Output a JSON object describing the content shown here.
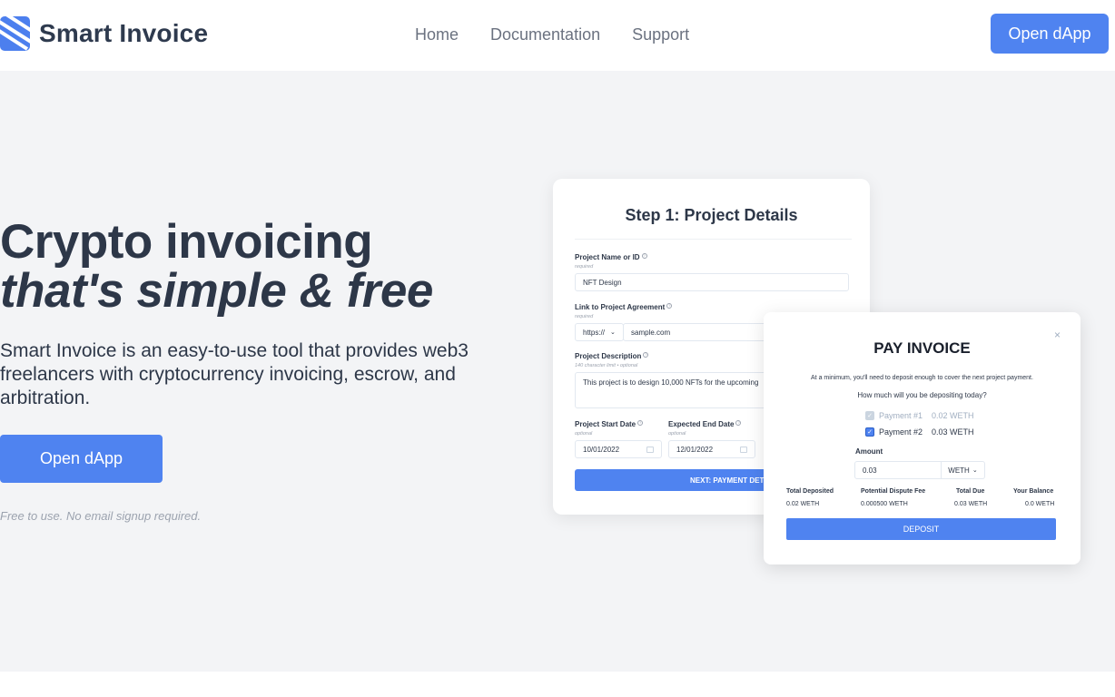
{
  "brand": {
    "name": "Smart Invoice",
    "accent": "#4f83f0"
  },
  "nav": {
    "items": [
      "Home",
      "Documentation",
      "Support"
    ],
    "cta": "Open dApp"
  },
  "hero": {
    "title_line1": "Crypto invoicing",
    "title_line2": "that's simple & free",
    "description": "Smart Invoice is an easy-to-use tool that provides web3 freelancers with cryptocurrency invoicing, escrow, and arbitration.",
    "cta": "Open dApp",
    "note": "Free to use. No email signup required."
  },
  "step_card": {
    "title": "Step 1: Project Details",
    "project_name": {
      "label": "Project Name or ID",
      "hint": "required",
      "value": "NFT Design"
    },
    "project_link": {
      "label": "Link to Project Agreement",
      "hint": "required",
      "protocol": "https://",
      "value": "sample.com"
    },
    "description": {
      "label": "Project Description",
      "hint": "140 character limit • optional",
      "value": "This project is to design 10,000 NFTs for the upcoming"
    },
    "start_date": {
      "label": "Project Start Date",
      "hint": "optional",
      "value": "10/01/2022"
    },
    "end_date": {
      "label": "Expected End Date",
      "hint": "optional",
      "value": "12/01/2022"
    },
    "next": "NEXT: PAYMENT DETAILS"
  },
  "pay_card": {
    "title": "PAY INVOICE",
    "close": "×",
    "min_text": "At a minimum, you'll need to deposit enough to cover the next project payment.",
    "question": "How much will you be depositing today?",
    "payments": [
      {
        "label": "Payment #1",
        "amount": "0.02 WETH",
        "checked": true,
        "disabled": true
      },
      {
        "label": "Payment #2",
        "amount": "0.03 WETH",
        "checked": true,
        "disabled": false
      }
    ],
    "amount_label": "Amount",
    "amount_value": "0.03",
    "token": "WETH",
    "summary": {
      "total_deposited": {
        "label": "Total Deposited",
        "value": "0.02 WETH"
      },
      "dispute_fee": {
        "label": "Potential Dispute Fee",
        "value": "0.000500 WETH"
      },
      "total_due": {
        "label": "Total Due",
        "value": "0.03 WETH"
      },
      "balance": {
        "label": "Your Balance",
        "value": "0.0 WETH"
      }
    },
    "deposit": "DEPOSIT"
  }
}
